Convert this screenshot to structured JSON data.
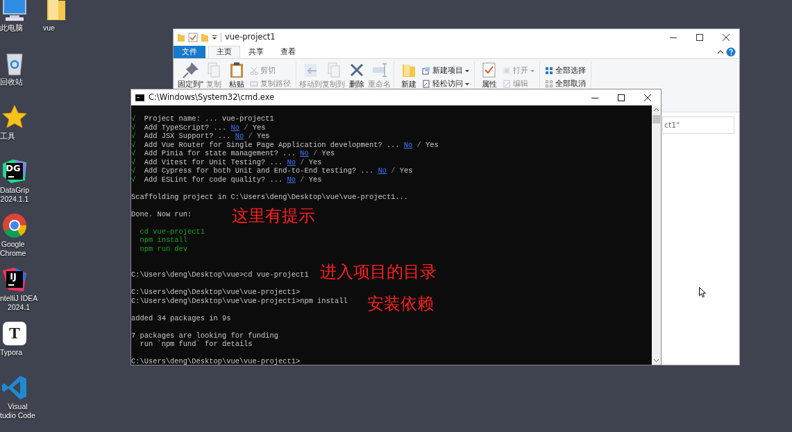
{
  "desktop": {
    "icons": [
      {
        "kind": "computer",
        "label": [
          "此电脑"
        ]
      },
      {
        "kind": "recycle_bin",
        "label": [
          "回收站"
        ]
      },
      {
        "kind": "star",
        "label": [
          "工具"
        ]
      },
      {
        "kind": "datagrip",
        "glyph": "DG",
        "label": [
          "DataGrip",
          "2024.1.1"
        ]
      },
      {
        "kind": "chrome",
        "label": [
          "Google",
          "Chrome"
        ]
      },
      {
        "kind": "intellij",
        "glyph": "IJ",
        "label": [
          "ntelliJ IDEA",
          "2024.1"
        ]
      },
      {
        "kind": "typora",
        "glyph": "T",
        "label": [
          "Typora"
        ]
      },
      {
        "kind": "vscode",
        "label": [
          "Visual",
          "tudio Code"
        ]
      },
      {
        "kind": "folder",
        "label": [
          "vue"
        ]
      }
    ]
  },
  "explorer": {
    "title": "vue-project1",
    "tabs": [
      {
        "label": "文件",
        "kind": "file_menu",
        "selected": false
      },
      {
        "label": "主页",
        "kind": "tab",
        "selected": true
      },
      {
        "label": "共享",
        "kind": "tab",
        "selected": false
      },
      {
        "label": "查看",
        "kind": "tab",
        "selected": false
      }
    ],
    "ribbon_groups": [
      [
        {
          "kind": "large",
          "label": "固定到\"",
          "disabled": false
        },
        {
          "kind": "large",
          "label": "复制",
          "disabled": true
        },
        {
          "kind": "large",
          "label": "粘贴",
          "disabled": false
        },
        {
          "kind": "stack",
          "items": [
            {
              "label": "剪切",
              "disabled": true,
              "caret": false
            },
            {
              "label": "复制路径",
              "disabled": true,
              "caret": false
            }
          ]
        }
      ],
      [
        {
          "kind": "large",
          "label": "移动到",
          "disabled": true
        },
        {
          "kind": "large",
          "label": "复制到",
          "disabled": true
        },
        {
          "kind": "large",
          "label": "删除",
          "disabled": false
        },
        {
          "kind": "large",
          "label": "重命名",
          "disabled": true
        }
      ],
      [
        {
          "kind": "large",
          "label": "新建",
          "disabled": false
        },
        {
          "kind": "stack",
          "items": [
            {
              "label": "新建项目",
              "disabled": false,
              "caret": true
            },
            {
              "label": "轻松访问",
              "disabled": false,
              "caret": true
            }
          ]
        }
      ],
      [
        {
          "kind": "large",
          "label": "属性",
          "disabled": false
        },
        {
          "kind": "stack",
          "items": [
            {
              "label": "打开",
              "disabled": true,
              "caret": true
            },
            {
              "label": "编辑",
              "disabled": true,
              "caret": false
            }
          ]
        }
      ],
      [
        {
          "kind": "stack",
          "items": [
            {
              "label": "全部选择",
              "disabled": false,
              "caret": false
            },
            {
              "label": "全部取消",
              "disabled": false,
              "caret": false
            }
          ]
        }
      ]
    ],
    "search": {
      "placeholder": "ct1\""
    }
  },
  "terminal": {
    "title": "C:\\Windows\\System32\\cmd.exe",
    "lines": [
      {
        "kind": "answer",
        "check": "√",
        "question": "Project name:",
        "dots": "...",
        "answer": "vue-project1"
      },
      {
        "kind": "choice",
        "check": "√",
        "question": "Add TypeScript?",
        "dots": "...",
        "separator": "/",
        "options": [
          {
            "label": "No",
            "selected": true
          },
          {
            "label": "Yes",
            "selected": false
          }
        ]
      },
      {
        "kind": "choice",
        "check": "√",
        "question": "Add JSX Support?",
        "dots": "...",
        "separator": "/",
        "options": [
          {
            "label": "No",
            "selected": true
          },
          {
            "label": "Yes",
            "selected": false
          }
        ]
      },
      {
        "kind": "choice",
        "check": "√",
        "question": "Add Vue Router for Single Page Application development?",
        "dots": "...",
        "separator": "/",
        "options": [
          {
            "label": "No",
            "selected": true
          },
          {
            "label": "Yes",
            "selected": false
          }
        ]
      },
      {
        "kind": "choice",
        "check": "√",
        "question": "Add Pinia for state management?",
        "dots": "...",
        "separator": "/",
        "options": [
          {
            "label": "No",
            "selected": true
          },
          {
            "label": "Yes",
            "selected": false
          }
        ]
      },
      {
        "kind": "choice",
        "check": "√",
        "question": "Add Vitest for Unit Testing?",
        "dots": "...",
        "separator": "/",
        "options": [
          {
            "label": "No",
            "selected": true
          },
          {
            "label": "Yes",
            "selected": false
          }
        ]
      },
      {
        "kind": "choice",
        "check": "√",
        "question": "Add Cypress for both Unit and End-to-End testing?",
        "dots": "...",
        "separator": "/",
        "options": [
          {
            "label": "No",
            "selected": true
          },
          {
            "label": "Yes",
            "selected": false
          }
        ]
      },
      {
        "kind": "choice",
        "check": "√",
        "question": "Add ESLint for code quality?",
        "dots": "...",
        "separator": "/",
        "options": [
          {
            "label": "No",
            "selected": true
          },
          {
            "label": "Yes",
            "selected": false
          }
        ]
      },
      {
        "kind": "blank"
      },
      {
        "kind": "output",
        "text": "Scaffolding project in C:\\Users\\deng\\Desktop\\vue\\vue-project1..."
      },
      {
        "kind": "blank"
      },
      {
        "kind": "output",
        "text": "Done. Now run:",
        "annotation": "这里有提示"
      },
      {
        "kind": "blank"
      },
      {
        "kind": "hint",
        "text": "cd vue-project1"
      },
      {
        "kind": "hint",
        "text": "npm install"
      },
      {
        "kind": "hint",
        "text": "npm run dev"
      },
      {
        "kind": "blank"
      },
      {
        "kind": "blank"
      },
      {
        "kind": "output",
        "text": "C:\\Users\\deng\\Desktop\\vue>cd vue-project1",
        "annotation": "进入项目的目录"
      },
      {
        "kind": "blank"
      },
      {
        "kind": "output",
        "text": "C:\\Users\\deng\\Desktop\\vue\\vue-project1>"
      },
      {
        "kind": "output",
        "text": "C:\\Users\\deng\\Desktop\\vue\\vue-project1>npm install",
        "annotation": "安装依赖"
      },
      {
        "kind": "blank"
      },
      {
        "kind": "output",
        "text": "added 34 packages in 9s"
      },
      {
        "kind": "blank"
      },
      {
        "kind": "output",
        "text": "7 packages are looking for funding"
      },
      {
        "kind": "detail",
        "text": "run `npm fund` for details"
      },
      {
        "kind": "blank"
      },
      {
        "kind": "output",
        "text": "C:\\Users\\deng\\Desktop\\vue\\vue-project1>"
      }
    ]
  }
}
